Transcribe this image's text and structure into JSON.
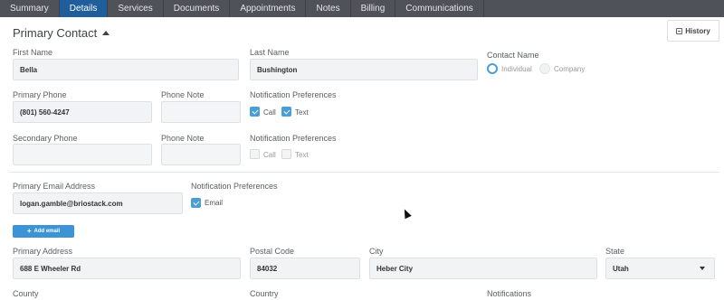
{
  "tabs": [
    {
      "label": "Summary",
      "active": false
    },
    {
      "label": "Details",
      "active": true
    },
    {
      "label": "Services",
      "active": false
    },
    {
      "label": "Documents",
      "active": false
    },
    {
      "label": "Appointments",
      "active": false
    },
    {
      "label": "Notes",
      "active": false
    },
    {
      "label": "Billing",
      "active": false
    },
    {
      "label": "Communications",
      "active": false
    }
  ],
  "section": {
    "title": "Primary Contact",
    "history_label": "History"
  },
  "labels": {
    "first_name": "First Name",
    "last_name": "Last Name",
    "contact_name": "Contact Name",
    "primary_phone": "Primary Phone",
    "phone_note_1": "Phone Note",
    "notif_pref_1": "Notification Preferences",
    "secondary_phone": "Secondary Phone",
    "phone_note_2": "Phone Note",
    "notif_pref_2": "Notification Preferences",
    "primary_email": "Primary Email Address",
    "notif_pref_3": "Notification Preferences",
    "primary_address": "Primary Address",
    "postal_code": "Postal Code",
    "city": "City",
    "state": "State",
    "county": "County",
    "country": "Country",
    "notifications": "Notifications"
  },
  "values": {
    "first_name": "Bella",
    "last_name": "Bushington",
    "primary_phone": "(801) 560-4247",
    "phone_note_1": "",
    "secondary_phone": "",
    "phone_note_2": "",
    "primary_email": "logan.gamble@briostack.com",
    "primary_address": "688 E Wheeler Rd",
    "postal_code": "84032",
    "city": "Heber City",
    "state": "Utah"
  },
  "contact_type": {
    "individual": "Individual",
    "company": "Company",
    "selected": "Individual"
  },
  "prefs": {
    "call": "Call",
    "text": "Text",
    "email": "Email",
    "primary_call_checked": true,
    "primary_text_checked": true,
    "secondary_call_checked": false,
    "secondary_text_checked": false,
    "email_checked": true
  },
  "buttons": {
    "add_email": "Add email"
  },
  "colors": {
    "tab_bar": "#4f5259",
    "active_tab": "#1f5e9a",
    "accent": "#4a9ed6"
  }
}
